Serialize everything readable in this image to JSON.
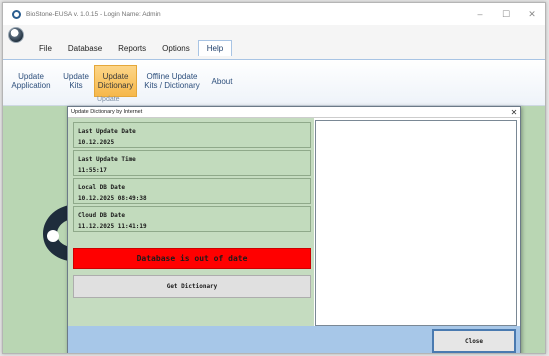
{
  "window": {
    "title": "BioStone-EUSA v. 1.0.15 - Login Name: Admin",
    "controls": {
      "minimize": "–",
      "maximize": "☐",
      "close": "✕"
    }
  },
  "menu": {
    "items": [
      {
        "label": "File"
      },
      {
        "label": "Database"
      },
      {
        "label": "Reports"
      },
      {
        "label": "Options"
      },
      {
        "label": "Help"
      }
    ],
    "active": "Help"
  },
  "ribbon": {
    "buttons": [
      {
        "line1": "Update",
        "line2": "Application"
      },
      {
        "line1": "Update",
        "line2": "Kits"
      },
      {
        "line1": "Update",
        "line2": "Dictionary"
      },
      {
        "line1": "Offline Update",
        "line2": "Kits / Dictionary"
      },
      {
        "line1": "About",
        "line2": ""
      }
    ],
    "selected": "Update Dictionary",
    "group_label": "Update"
  },
  "dialog": {
    "title": "Update Dictionary by Internet",
    "close_glyph": "✕",
    "fields": [
      {
        "label": "Last Update Date",
        "value": "10.12.2025"
      },
      {
        "label": "Last Update Time",
        "value": "11:55:17"
      },
      {
        "label": "Local DB Date",
        "value": "10.12.2025 08:49:38"
      },
      {
        "label": "Cloud DB Date",
        "value": "11.12.2025 11:41:19"
      }
    ],
    "status": "Database is out of date",
    "get_button": "Get Dictionary",
    "close_button": "Close"
  },
  "colors": {
    "status_bg": "#ff0000",
    "pane_bg": "#c5dcc0",
    "footer_bg": "#a7c7e8",
    "ribbon_selected": "#f6b84b"
  }
}
